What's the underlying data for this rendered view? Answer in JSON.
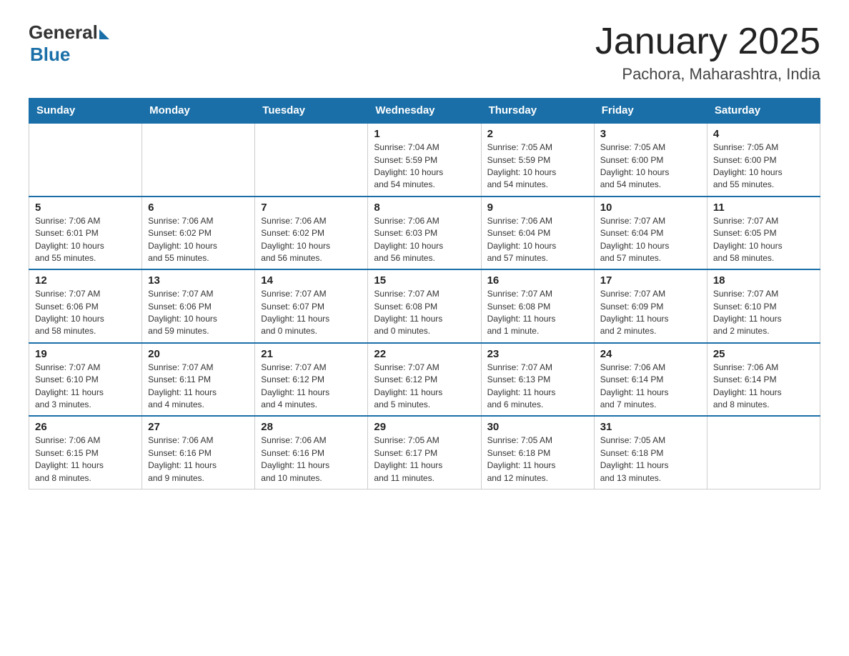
{
  "header": {
    "logo_text_general": "General",
    "logo_text_blue": "Blue",
    "title": "January 2025",
    "subtitle": "Pachora, Maharashtra, India"
  },
  "days_of_week": [
    "Sunday",
    "Monday",
    "Tuesday",
    "Wednesday",
    "Thursday",
    "Friday",
    "Saturday"
  ],
  "weeks": [
    [
      {
        "day": "",
        "info": ""
      },
      {
        "day": "",
        "info": ""
      },
      {
        "day": "",
        "info": ""
      },
      {
        "day": "1",
        "info": "Sunrise: 7:04 AM\nSunset: 5:59 PM\nDaylight: 10 hours\nand 54 minutes."
      },
      {
        "day": "2",
        "info": "Sunrise: 7:05 AM\nSunset: 5:59 PM\nDaylight: 10 hours\nand 54 minutes."
      },
      {
        "day": "3",
        "info": "Sunrise: 7:05 AM\nSunset: 6:00 PM\nDaylight: 10 hours\nand 54 minutes."
      },
      {
        "day": "4",
        "info": "Sunrise: 7:05 AM\nSunset: 6:00 PM\nDaylight: 10 hours\nand 55 minutes."
      }
    ],
    [
      {
        "day": "5",
        "info": "Sunrise: 7:06 AM\nSunset: 6:01 PM\nDaylight: 10 hours\nand 55 minutes."
      },
      {
        "day": "6",
        "info": "Sunrise: 7:06 AM\nSunset: 6:02 PM\nDaylight: 10 hours\nand 55 minutes."
      },
      {
        "day": "7",
        "info": "Sunrise: 7:06 AM\nSunset: 6:02 PM\nDaylight: 10 hours\nand 56 minutes."
      },
      {
        "day": "8",
        "info": "Sunrise: 7:06 AM\nSunset: 6:03 PM\nDaylight: 10 hours\nand 56 minutes."
      },
      {
        "day": "9",
        "info": "Sunrise: 7:06 AM\nSunset: 6:04 PM\nDaylight: 10 hours\nand 57 minutes."
      },
      {
        "day": "10",
        "info": "Sunrise: 7:07 AM\nSunset: 6:04 PM\nDaylight: 10 hours\nand 57 minutes."
      },
      {
        "day": "11",
        "info": "Sunrise: 7:07 AM\nSunset: 6:05 PM\nDaylight: 10 hours\nand 58 minutes."
      }
    ],
    [
      {
        "day": "12",
        "info": "Sunrise: 7:07 AM\nSunset: 6:06 PM\nDaylight: 10 hours\nand 58 minutes."
      },
      {
        "day": "13",
        "info": "Sunrise: 7:07 AM\nSunset: 6:06 PM\nDaylight: 10 hours\nand 59 minutes."
      },
      {
        "day": "14",
        "info": "Sunrise: 7:07 AM\nSunset: 6:07 PM\nDaylight: 11 hours\nand 0 minutes."
      },
      {
        "day": "15",
        "info": "Sunrise: 7:07 AM\nSunset: 6:08 PM\nDaylight: 11 hours\nand 0 minutes."
      },
      {
        "day": "16",
        "info": "Sunrise: 7:07 AM\nSunset: 6:08 PM\nDaylight: 11 hours\nand 1 minute."
      },
      {
        "day": "17",
        "info": "Sunrise: 7:07 AM\nSunset: 6:09 PM\nDaylight: 11 hours\nand 2 minutes."
      },
      {
        "day": "18",
        "info": "Sunrise: 7:07 AM\nSunset: 6:10 PM\nDaylight: 11 hours\nand 2 minutes."
      }
    ],
    [
      {
        "day": "19",
        "info": "Sunrise: 7:07 AM\nSunset: 6:10 PM\nDaylight: 11 hours\nand 3 minutes."
      },
      {
        "day": "20",
        "info": "Sunrise: 7:07 AM\nSunset: 6:11 PM\nDaylight: 11 hours\nand 4 minutes."
      },
      {
        "day": "21",
        "info": "Sunrise: 7:07 AM\nSunset: 6:12 PM\nDaylight: 11 hours\nand 4 minutes."
      },
      {
        "day": "22",
        "info": "Sunrise: 7:07 AM\nSunset: 6:12 PM\nDaylight: 11 hours\nand 5 minutes."
      },
      {
        "day": "23",
        "info": "Sunrise: 7:07 AM\nSunset: 6:13 PM\nDaylight: 11 hours\nand 6 minutes."
      },
      {
        "day": "24",
        "info": "Sunrise: 7:06 AM\nSunset: 6:14 PM\nDaylight: 11 hours\nand 7 minutes."
      },
      {
        "day": "25",
        "info": "Sunrise: 7:06 AM\nSunset: 6:14 PM\nDaylight: 11 hours\nand 8 minutes."
      }
    ],
    [
      {
        "day": "26",
        "info": "Sunrise: 7:06 AM\nSunset: 6:15 PM\nDaylight: 11 hours\nand 8 minutes."
      },
      {
        "day": "27",
        "info": "Sunrise: 7:06 AM\nSunset: 6:16 PM\nDaylight: 11 hours\nand 9 minutes."
      },
      {
        "day": "28",
        "info": "Sunrise: 7:06 AM\nSunset: 6:16 PM\nDaylight: 11 hours\nand 10 minutes."
      },
      {
        "day": "29",
        "info": "Sunrise: 7:05 AM\nSunset: 6:17 PM\nDaylight: 11 hours\nand 11 minutes."
      },
      {
        "day": "30",
        "info": "Sunrise: 7:05 AM\nSunset: 6:18 PM\nDaylight: 11 hours\nand 12 minutes."
      },
      {
        "day": "31",
        "info": "Sunrise: 7:05 AM\nSunset: 6:18 PM\nDaylight: 11 hours\nand 13 minutes."
      },
      {
        "day": "",
        "info": ""
      }
    ]
  ]
}
